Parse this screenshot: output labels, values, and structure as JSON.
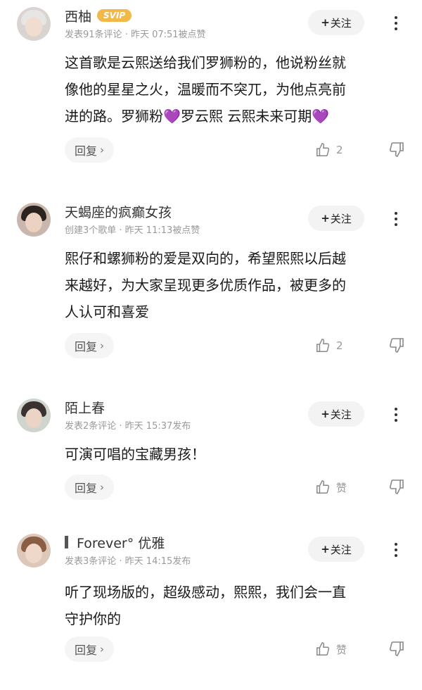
{
  "comments": [
    {
      "username": "西柚",
      "badge": "SVIP",
      "meta": "发表91条评论 · 昨天 07:51被点赞",
      "follow_label": "关注",
      "lines": [
        "这首歌是云熙送给我们罗狮粉的，他说粉丝就",
        "像他的星星之火，温暖而不突兀，为他点亮前",
        "进的路。罗狮粉",
        "罗云熙 云熙未来可期"
      ],
      "heart_glyph": "💜",
      "reply_label": "回复",
      "like_count": "2"
    },
    {
      "username": "天蝎座的疯癫女孩",
      "meta": "创建3个歌单 · 昨天 11:13被点赞",
      "follow_label": "关注",
      "lines": [
        "熙仔和螺狮粉的爱是双向的，希望熙熙以后越",
        "来越好，为大家呈现更多优质作品，被更多的",
        "人认可和喜爱"
      ],
      "reply_label": "回复",
      "like_count": "2"
    },
    {
      "username": "陌上春",
      "meta": "发表2条评论 · 昨天 15:37发布",
      "follow_label": "关注",
      "lines": [
        "可演可唱的宝藏男孩！"
      ],
      "reply_label": "回复",
      "like_count": "赞"
    },
    {
      "username": "Forever° 优雅",
      "meta": "发表3条评论 · 昨天 14:15发布",
      "follow_label": "关注",
      "lines": [
        "听了现场版的，超级感动，熙熙，我们会一直",
        "守护你的"
      ],
      "reply_label": "回复",
      "like_count": "赞"
    }
  ],
  "symbols": {
    "plus": "+",
    "chevron": "›"
  },
  "colors": {
    "svip": "#f0b94a",
    "heart": "#a24de0",
    "meta_text": "#9a9a9a"
  }
}
